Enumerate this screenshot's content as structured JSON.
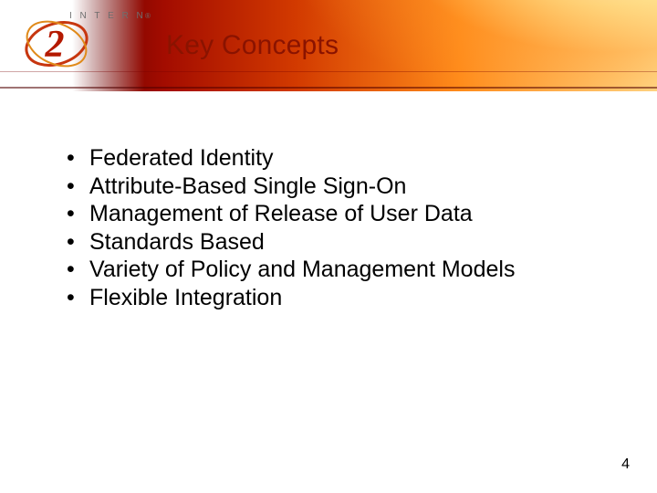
{
  "header": {
    "logo_text_top": "INTERNET",
    "logo_mark": "2",
    "title": "Key Concepts"
  },
  "bullets": [
    "Federated Identity",
    "Attribute-Based Single Sign-On",
    "Management of Release of User Data",
    "Standards Based",
    "Variety of Policy and Management Models",
    "Flexible Integration"
  ],
  "page_number": "4"
}
